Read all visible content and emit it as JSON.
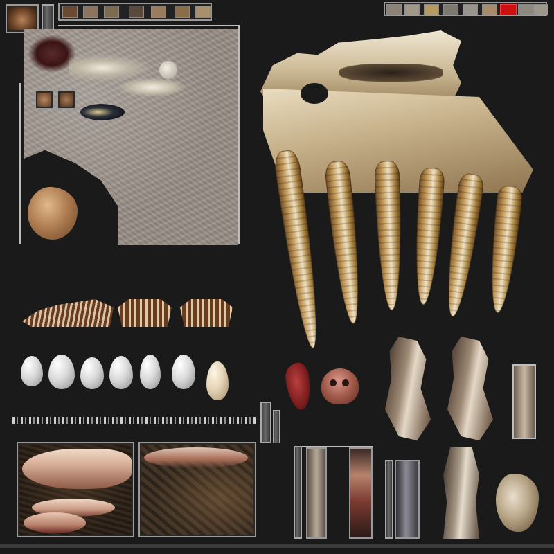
{
  "atlas": {
    "colors": {
      "background": "#1a1a1a",
      "frame": "#9a9a9a",
      "bone": "#e4d6b8",
      "fang": "#c49a5a",
      "rock": "#9a9088",
      "flesh": "#8a2a2a",
      "highlight_red": "#cc1111"
    },
    "top_icon_strip": [
      "shell-icon",
      "bone-fragment-icon",
      "claw-icon",
      "skull-icon",
      "vertebra-icon",
      "horn-icon",
      "tooth-icon"
    ],
    "top_right_strip": [
      "bone-icon",
      "bone-icon",
      "fossil-icon",
      "fossil-icon",
      "skull-icon",
      "shell-icon",
      "selected-slot",
      "bone-icon",
      "bone-icon"
    ],
    "small_slots": [
      "rock-chunk-icon",
      "rock-chunk-icon"
    ],
    "eggs": [
      "egg-1",
      "egg-2",
      "egg-3",
      "egg-4",
      "egg-5",
      "egg-6",
      "egg-7-tan"
    ],
    "jaw_fangs": 6,
    "bone_segments": [
      "fish-skeleton-segment",
      "rib-segment",
      "rib-segment"
    ]
  }
}
